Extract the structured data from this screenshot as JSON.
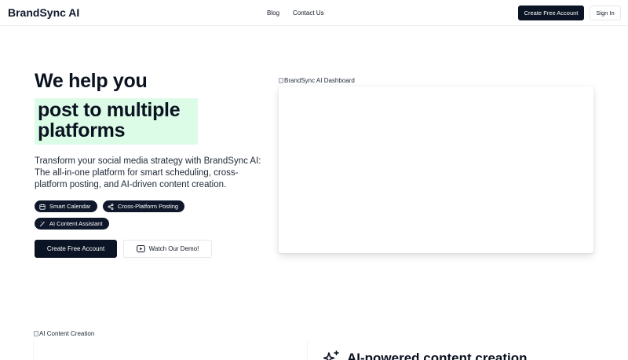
{
  "nav": {
    "brand": "BrandSync AI",
    "links": [
      "Blog",
      "Contact Us"
    ],
    "create_account": "Create Free Account",
    "sign_in": "Sign In"
  },
  "hero": {
    "heading_line1": "We help you",
    "highlight_line1": "post to multiple",
    "highlight_line2": "platforms",
    "highlight_color": "#dcfce7",
    "description": "Transform your social media strategy with BrandSync AI: The all-in-one platform for smart scheduling, cross-platform posting, and AI-driven content creation.",
    "tags": [
      {
        "label": "Smart Calendar",
        "icon": "calendar-icon"
      },
      {
        "label": "Cross-Platform Posting",
        "icon": "share-icon"
      },
      {
        "label": "AI Content Assistant",
        "icon": "magic-wand-icon"
      }
    ],
    "primary_cta": "Create Free Account",
    "secondary_cta": "Watch Our Demo!",
    "secondary_cta_icon": "video-play-icon",
    "dashboard_alt": "BrandSync AI Dashboard"
  },
  "section2": {
    "image_alt": "AI Content Creation",
    "title": "AI-powered content creation",
    "icon": "sparkles-icon"
  },
  "colors": {
    "dark": "#0b1424",
    "accent_green": "#dcfce7"
  }
}
